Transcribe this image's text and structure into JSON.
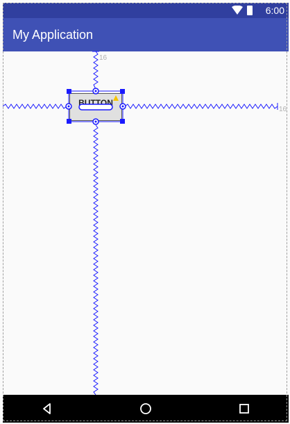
{
  "status_bar": {
    "time": "6:00",
    "icons": [
      "wifi-icon",
      "battery-icon"
    ]
  },
  "app_bar": {
    "title": "My Application"
  },
  "widget": {
    "label": "BUTTON"
  },
  "constraints": {
    "top_margin": "16",
    "end_margin": "16"
  },
  "nav_bar": {
    "buttons": [
      "back-icon",
      "home-icon",
      "recents-icon"
    ]
  },
  "colors": {
    "primary_dark": "#303f9f",
    "primary": "#3f51b5",
    "constraint": "#1a1aff"
  }
}
